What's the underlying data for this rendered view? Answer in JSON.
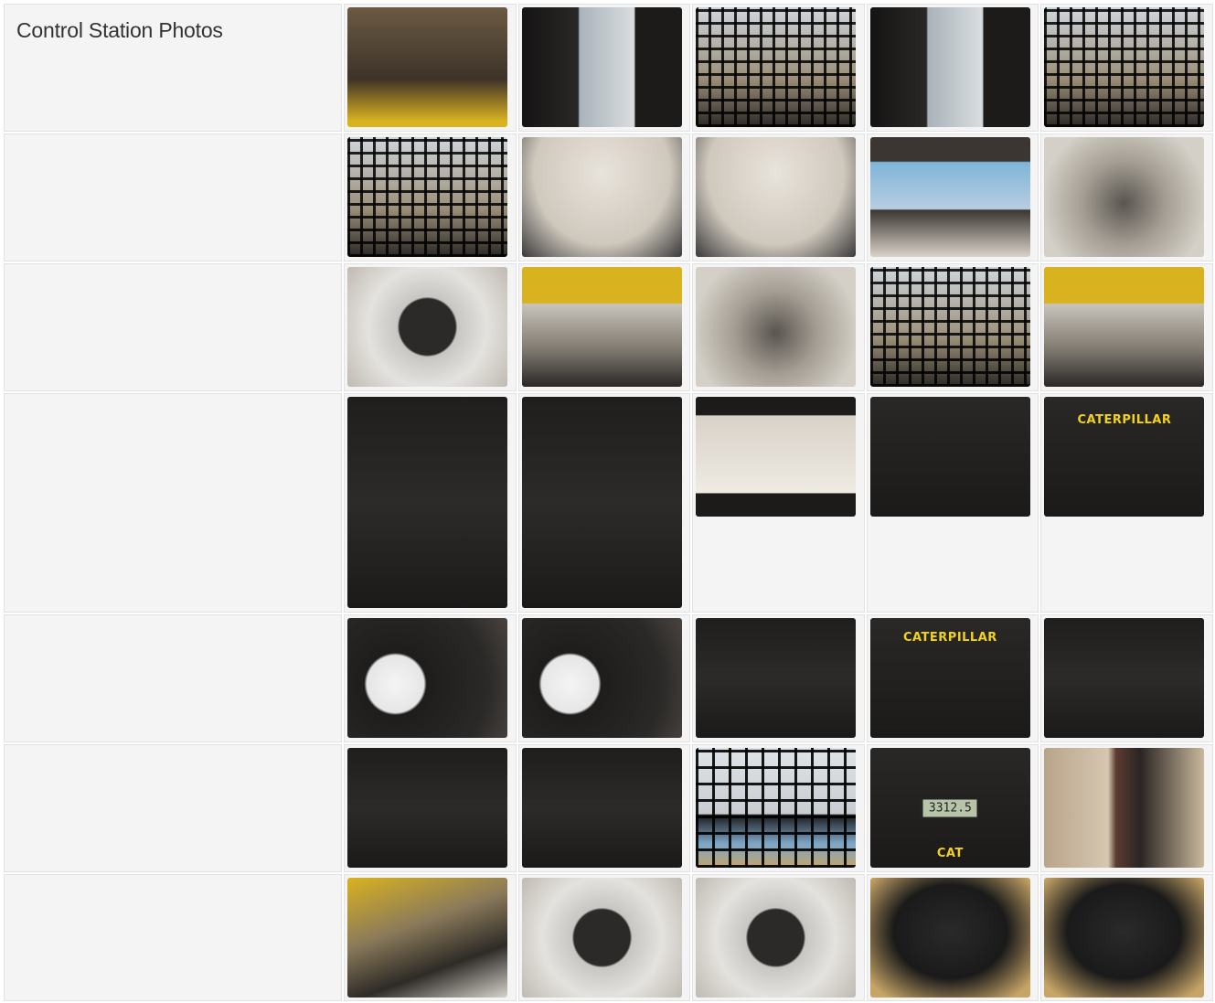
{
  "section": {
    "title": "Control Station Photos"
  },
  "photos": {
    "row1": [
      "floor-pedals",
      "side-door-latch",
      "front-cage-window",
      "door-handle",
      "cage-window-view"
    ],
    "row2": [
      "rear-cage",
      "roof-liner-cracks",
      "roof-liner-cracks-2",
      "rear-window",
      "floor-corner"
    ],
    "row3": [
      "air-vent",
      "joystick-left",
      "throttle-knob",
      "joystick-grip",
      "joystick-right"
    ],
    "row4": [
      "heater-vent",
      "fan-switch-panel",
      "dome-light",
      "switch-panel",
      "caterpillar-decal"
    ],
    "row5": [
      "fuel-gauge-switches",
      "fuel-gauge",
      "rocker-switches",
      "caterpillar-indicator-panel",
      "indicator-switches"
    ],
    "row6": [
      "switch-panel-2",
      "ignition-key",
      "rearview-mirror",
      "hour-meter",
      "exterior-mirror-arm"
    ],
    "row7": [
      "side-console",
      "vent-left",
      "vent-right",
      "seat-base",
      "operator-seat"
    ]
  },
  "decals": {
    "caterpillar": "CATERPILLAR",
    "hour_meter": "3312.5",
    "cat": "CAT"
  }
}
